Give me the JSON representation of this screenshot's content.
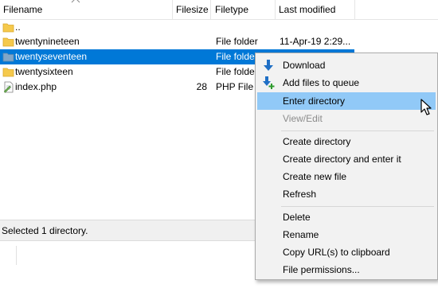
{
  "columns": {
    "filename": "Filename",
    "filesize": "Filesize",
    "filetype": "Filetype",
    "last_modified": "Last modified"
  },
  "files": [
    {
      "name": "..",
      "size": "",
      "type": "",
      "modified": "",
      "icon": "folder-icon"
    },
    {
      "name": "twentynineteen",
      "size": "",
      "type": "File folder",
      "modified": "11-Apr-19 2:29...",
      "icon": "folder-icon"
    },
    {
      "name": "twentyseventeen",
      "size": "",
      "type": "File folde",
      "modified": "",
      "icon": "folder-icon",
      "selected": true
    },
    {
      "name": "twentysixteen",
      "size": "",
      "type": "File folde",
      "modified": "",
      "icon": "folder-icon"
    },
    {
      "name": "index.php",
      "size": "28",
      "type": "PHP File",
      "modified": "",
      "icon": "php-file-icon"
    }
  ],
  "status": {
    "text": "Selected 1 directory."
  },
  "context_menu": {
    "items": [
      {
        "label": "Download",
        "icon": "download-icon"
      },
      {
        "label": "Add files to queue",
        "icon": "add-to-queue-icon"
      },
      {
        "label": "Enter directory",
        "hovered": true
      },
      {
        "label": "View/Edit",
        "disabled": true
      },
      {
        "label": "Create directory"
      },
      {
        "label": "Create directory and enter it"
      },
      {
        "label": "Create new file"
      },
      {
        "label": "Refresh"
      },
      {
        "label": "Delete"
      },
      {
        "label": "Rename"
      },
      {
        "label": "Copy URL(s) to clipboard"
      },
      {
        "label": "File permissions..."
      }
    ]
  },
  "colors": {
    "selection": "#0078d7",
    "menu_hover": "#91c9f7",
    "folder": "#f5c94c"
  }
}
